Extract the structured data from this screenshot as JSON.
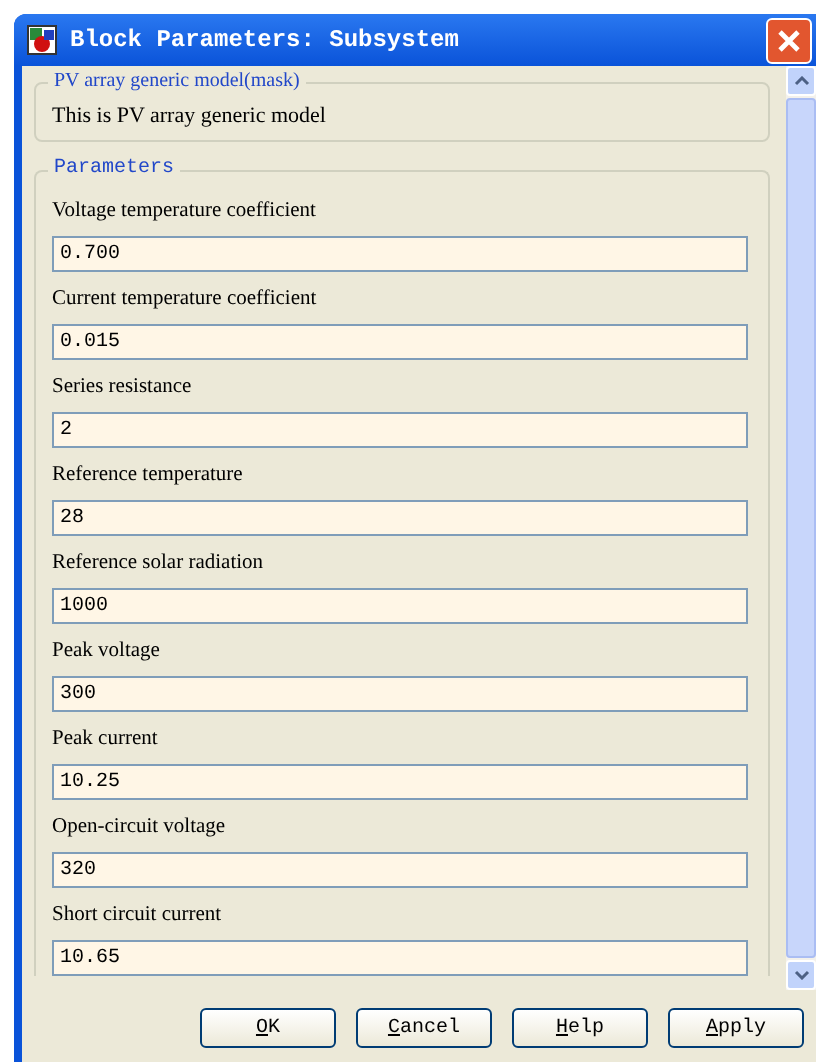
{
  "window": {
    "title": "Block Parameters: Subsystem"
  },
  "description": {
    "title": "PV array generic model(mask)",
    "text": "This is PV array generic model"
  },
  "parameters": {
    "title": "Parameters",
    "fields": [
      {
        "label": "Voltage temperature coefficient",
        "value": "0.700"
      },
      {
        "label": "Current temperature coefficient",
        "value": "0.015"
      },
      {
        "label": "Series resistance",
        "value": "2"
      },
      {
        "label": "Reference temperature",
        "value": "28"
      },
      {
        "label": "Reference solar radiation",
        "value": "1000"
      },
      {
        "label": "Peak voltage",
        "value": "300"
      },
      {
        "label": "Peak current",
        "value": "10.25"
      },
      {
        "label": "Open-circuit voltage",
        "value": "320"
      },
      {
        "label": "Short circuit current",
        "value": "10.65"
      }
    ]
  },
  "buttons": [
    {
      "key": "O",
      "rest": "K"
    },
    {
      "key": "C",
      "rest": "ancel"
    },
    {
      "key": "H",
      "rest": "elp"
    },
    {
      "key": "A",
      "rest": "pply"
    }
  ]
}
